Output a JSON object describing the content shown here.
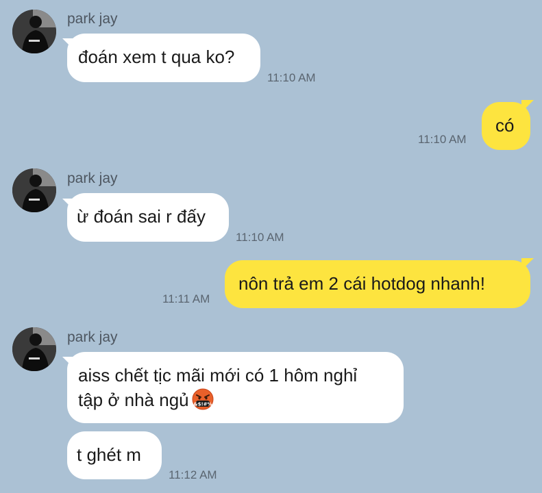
{
  "messages": [
    {
      "sender": "park jay",
      "text": "đoán xem t qua ko?",
      "time": "11:10 AM"
    },
    {
      "text": "có",
      "time": "11:10 AM"
    },
    {
      "sender": "park jay",
      "text": "ừ đoán sai r đấy",
      "time": "11:10 AM"
    },
    {
      "text": "nôn trả em 2 cái hotdog nhanh!",
      "time": "11:11 AM"
    },
    {
      "sender": "park jay",
      "line1": "aiss chết tịc mãi mới có 1 hôm nghỉ",
      "line2": "tập ở nhà ngủ"
    },
    {
      "text": "t ghét m",
      "time": "11:12 AM"
    }
  ],
  "emoji": {
    "name": "cursing-face-icon",
    "symbols": "&$!#%"
  },
  "colors": {
    "background": "#abc1d4",
    "incoming": "#ffffff",
    "outgoing": "#fde43f",
    "cursing_face": "#e8602a"
  }
}
